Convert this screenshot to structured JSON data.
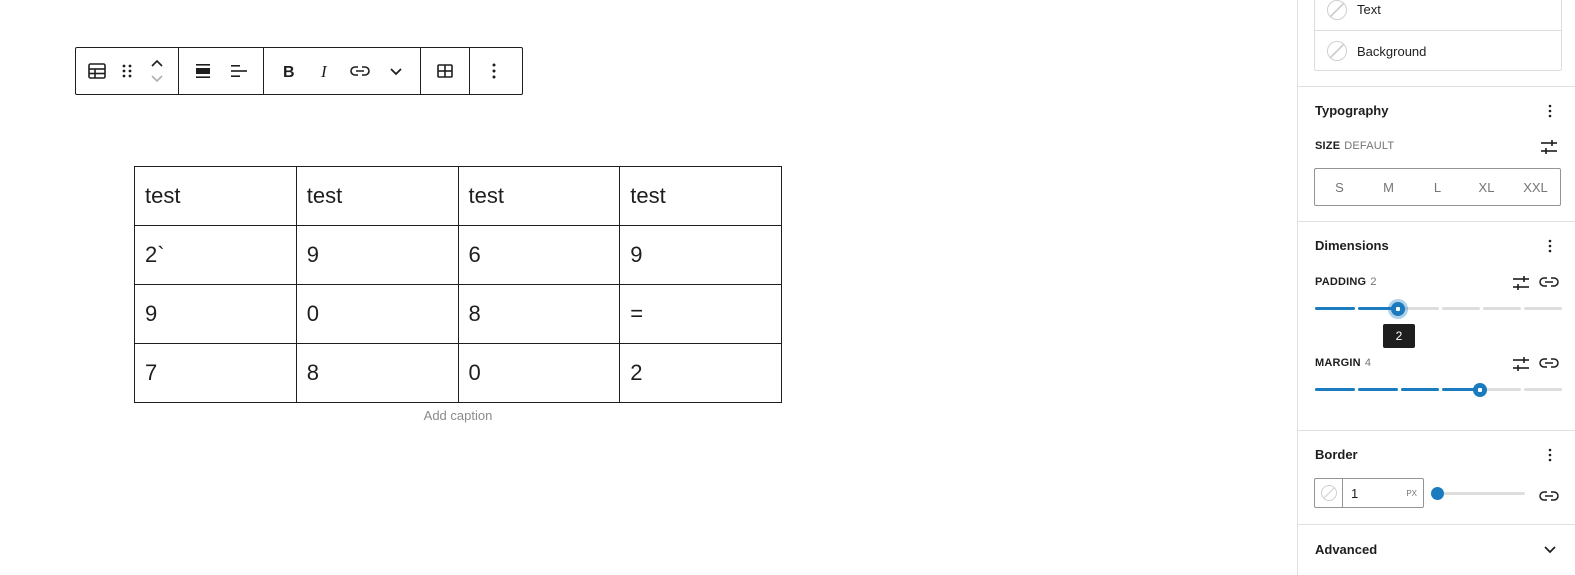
{
  "toolbar": {
    "buttons": [
      "table-icon",
      "drag-handle-icon",
      "move-up-icon",
      "move-down-icon",
      "align-wide-icon",
      "align-left-icon",
      "bold-icon",
      "italic-icon",
      "link-icon",
      "more-rich-text-icon",
      "edit-table-icon",
      "options-icon"
    ]
  },
  "table": {
    "rows": [
      [
        "test",
        "test",
        "test",
        "test"
      ],
      [
        "2`",
        "9",
        "6",
        "9"
      ],
      [
        "9",
        "0",
        "8",
        "="
      ],
      [
        "7",
        "8",
        "0",
        "2"
      ]
    ],
    "caption_placeholder": "Add caption"
  },
  "sidebar": {
    "color": {
      "text_label": "Text",
      "background_label": "Background"
    },
    "typography": {
      "title": "Typography",
      "size_label": "SIZE",
      "size_value": "DEFAULT",
      "sizes": [
        "S",
        "M",
        "L",
        "XL",
        "XXL"
      ]
    },
    "dimensions": {
      "title": "Dimensions",
      "padding_label": "PADDING",
      "padding_value": "2",
      "padding_tooltip": "2",
      "margin_label": "MARGIN",
      "margin_value": "4"
    },
    "border": {
      "title": "Border",
      "width_value": "1",
      "unit": "PX",
      "width_fraction": 0
    },
    "advanced": {
      "title": "Advanced"
    }
  },
  "colors": {
    "accent": "#1a7bbf",
    "text": "#1e1e1e",
    "muted": "#757575",
    "border": "#e0e0e0"
  }
}
